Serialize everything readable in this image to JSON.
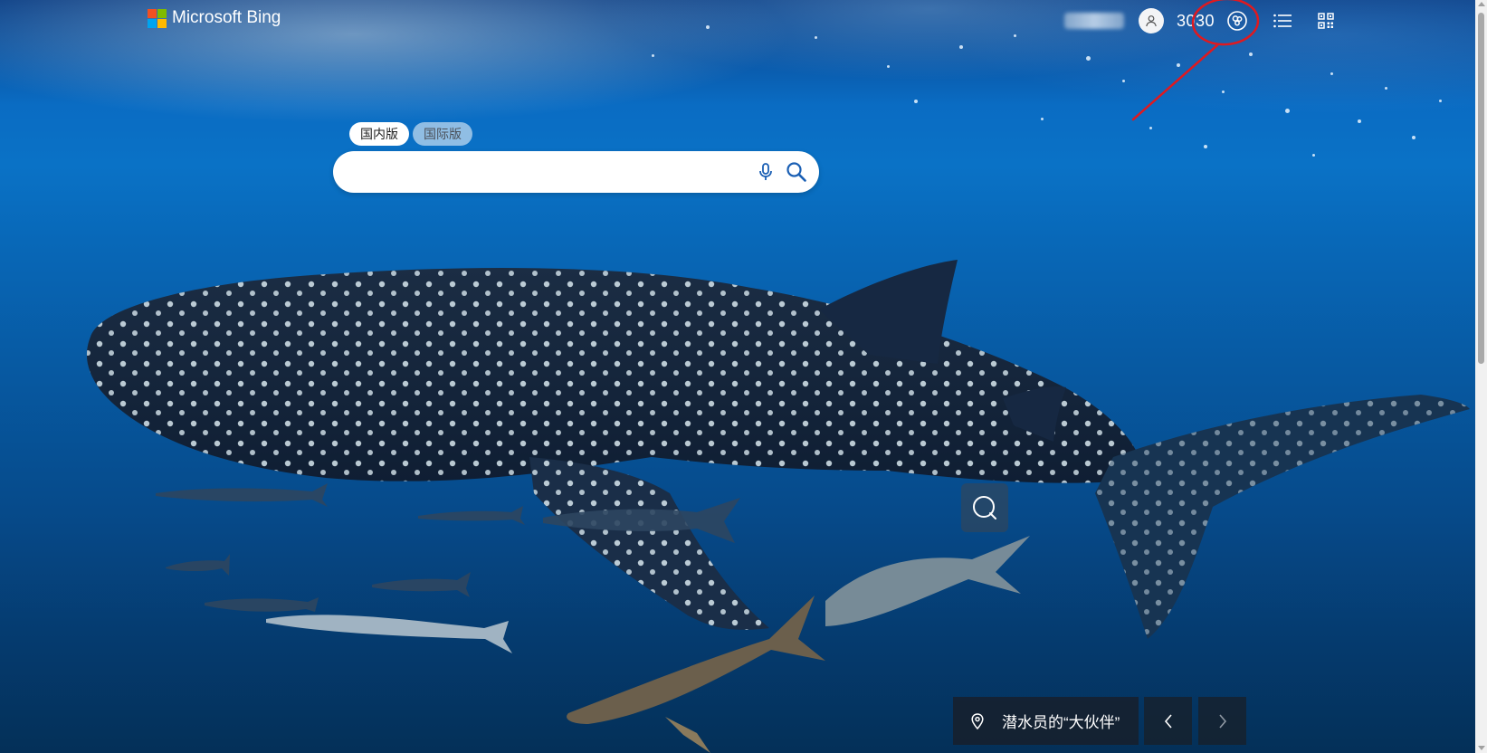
{
  "brand": {
    "name": "Microsoft Bing",
    "logo_colors": [
      "#f25022",
      "#7fba00",
      "#00a4ef",
      "#ffb900"
    ]
  },
  "header": {
    "rewards_points": "3030",
    "icons": [
      "avatar-icon",
      "rewards-icon",
      "menu-icon",
      "qr-code-icon"
    ]
  },
  "search": {
    "tabs": [
      {
        "label": "国内版",
        "active": true
      },
      {
        "label": "国际版",
        "active": false
      }
    ],
    "value": "",
    "placeholder": ""
  },
  "image": {
    "caption": "潜水员的“大伙伴”"
  },
  "colors": {
    "annotation": "#e0191f",
    "caption_bg": "#191e26"
  }
}
